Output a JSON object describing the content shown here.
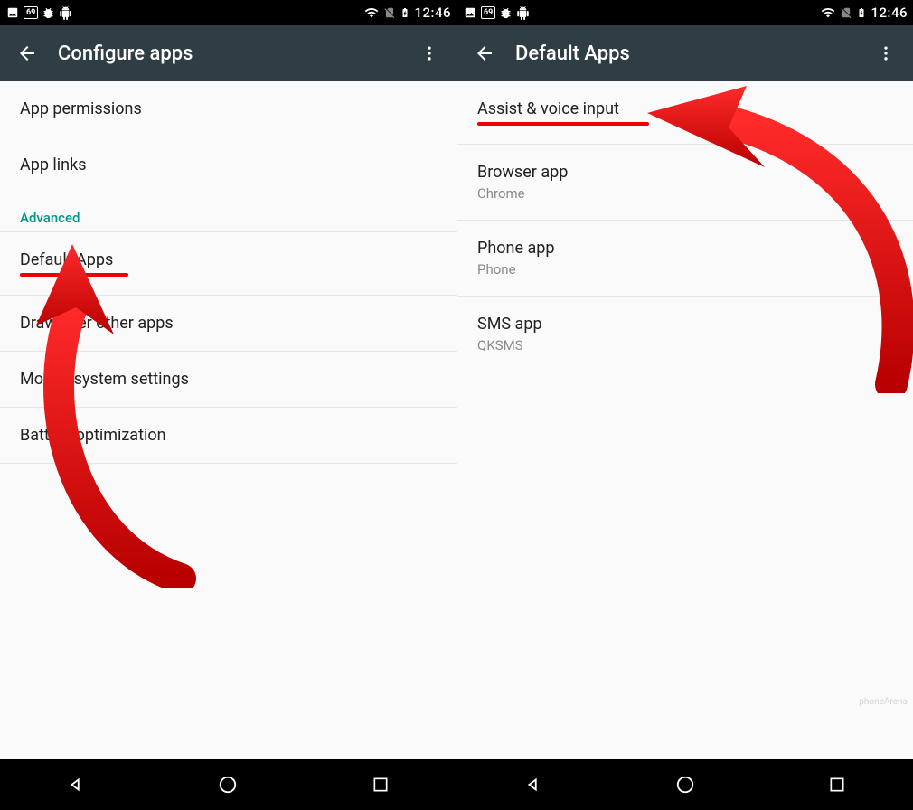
{
  "status": {
    "battery_box": "69",
    "time": "12:46"
  },
  "left": {
    "title": "Configure apps",
    "rows": {
      "app_permissions": "App permissions",
      "app_links": "App links",
      "section_advanced": "Advanced",
      "default_apps": "Default Apps",
      "draw_over": "Draw over other apps",
      "modify_system": "Modify system settings",
      "battery_opt": "Battery optimization"
    }
  },
  "right": {
    "title": "Default Apps",
    "rows": {
      "assist": {
        "primary": "Assist & voice input"
      },
      "browser": {
        "primary": "Browser app",
        "secondary": "Chrome"
      },
      "phone": {
        "primary": "Phone app",
        "secondary": "Phone"
      },
      "sms": {
        "primary": "SMS app",
        "secondary": "QKSMS"
      }
    }
  },
  "watermark": "phoneArena"
}
